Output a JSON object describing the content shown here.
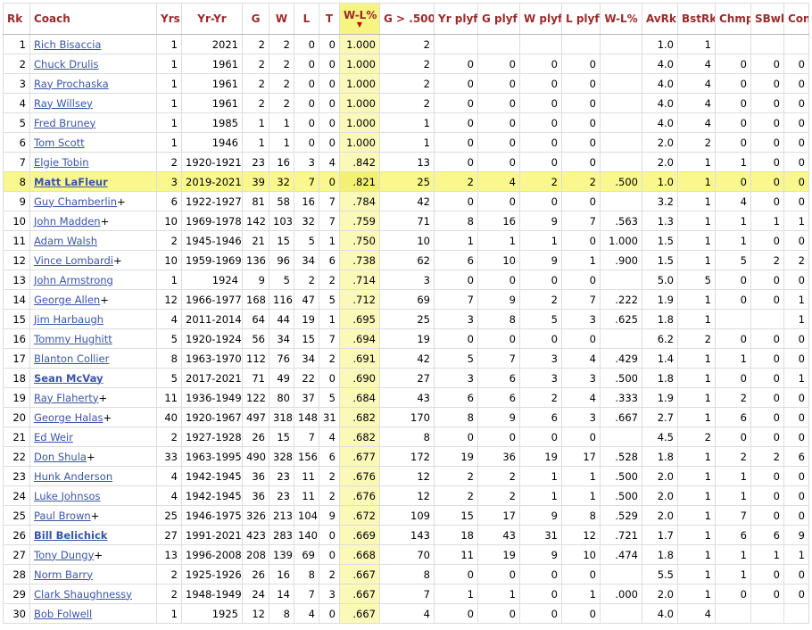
{
  "columns": [
    {
      "label": "Rk"
    },
    {
      "label": "Coach"
    },
    {
      "label": "Yrs"
    },
    {
      "label": "Yr-Yr"
    },
    {
      "label": "G"
    },
    {
      "label": "W"
    },
    {
      "label": "L"
    },
    {
      "label": "T"
    },
    {
      "label": "W-L%",
      "sort_indicator": "▼"
    },
    {
      "label": "G > .500"
    },
    {
      "label": "Yr plyf"
    },
    {
      "label": "G plyf"
    },
    {
      "label": "W plyf"
    },
    {
      "label": "L plyf"
    },
    {
      "label": "W-L%"
    },
    {
      "label": "AvRk"
    },
    {
      "label": "BstRk"
    },
    {
      "label": "Chmp"
    },
    {
      "label": "SBwl"
    },
    {
      "label": "Conf"
    }
  ],
  "rows": [
    {
      "rk": "1",
      "coach": "Rich Bisaccia",
      "hof": "",
      "bold": false,
      "highlight": false,
      "cells": [
        "1",
        "2021",
        "2",
        "2",
        "0",
        "0",
        "1.000",
        "2",
        "",
        "",
        "",
        "",
        "",
        "1.0",
        "1",
        "",
        "",
        ""
      ]
    },
    {
      "rk": "2",
      "coach": "Chuck Drulis",
      "hof": "",
      "bold": false,
      "highlight": false,
      "cells": [
        "1",
        "1961",
        "2",
        "2",
        "0",
        "0",
        "1.000",
        "2",
        "0",
        "0",
        "0",
        "0",
        "",
        "4.0",
        "4",
        "0",
        "0",
        "0"
      ]
    },
    {
      "rk": "3",
      "coach": "Ray Prochaska",
      "hof": "",
      "bold": false,
      "highlight": false,
      "cells": [
        "1",
        "1961",
        "2",
        "2",
        "0",
        "0",
        "1.000",
        "2",
        "0",
        "0",
        "0",
        "0",
        "",
        "4.0",
        "4",
        "0",
        "0",
        "0"
      ]
    },
    {
      "rk": "4",
      "coach": "Ray Willsey",
      "hof": "",
      "bold": false,
      "highlight": false,
      "cells": [
        "1",
        "1961",
        "2",
        "2",
        "0",
        "0",
        "1.000",
        "2",
        "0",
        "0",
        "0",
        "0",
        "",
        "4.0",
        "4",
        "0",
        "0",
        "0"
      ]
    },
    {
      "rk": "5",
      "coach": "Fred Bruney",
      "hof": "",
      "bold": false,
      "highlight": false,
      "cells": [
        "1",
        "1985",
        "1",
        "1",
        "0",
        "0",
        "1.000",
        "1",
        "0",
        "0",
        "0",
        "0",
        "",
        "4.0",
        "4",
        "0",
        "0",
        "0"
      ]
    },
    {
      "rk": "6",
      "coach": "Tom Scott",
      "hof": "",
      "bold": false,
      "highlight": false,
      "cells": [
        "1",
        "1946",
        "1",
        "1",
        "0",
        "0",
        "1.000",
        "1",
        "0",
        "0",
        "0",
        "0",
        "",
        "2.0",
        "2",
        "0",
        "0",
        "0"
      ]
    },
    {
      "rk": "7",
      "coach": "Elgie Tobin",
      "hof": "",
      "bold": false,
      "highlight": false,
      "cells": [
        "2",
        "1920-1921",
        "23",
        "16",
        "3",
        "4",
        ".842",
        "13",
        "0",
        "0",
        "0",
        "0",
        "",
        "2.0",
        "1",
        "1",
        "0",
        "0"
      ]
    },
    {
      "rk": "8",
      "coach": "Matt LaFleur",
      "hof": "",
      "bold": true,
      "highlight": true,
      "cells": [
        "3",
        "2019-2021",
        "39",
        "32",
        "7",
        "0",
        ".821",
        "25",
        "2",
        "4",
        "2",
        "2",
        ".500",
        "1.0",
        "1",
        "0",
        "0",
        "0"
      ]
    },
    {
      "rk": "9",
      "coach": "Guy Chamberlin",
      "hof": "+",
      "bold": false,
      "highlight": false,
      "cells": [
        "6",
        "1922-1927",
        "81",
        "58",
        "16",
        "7",
        ".784",
        "42",
        "0",
        "0",
        "0",
        "0",
        "",
        "3.2",
        "1",
        "4",
        "0",
        "0"
      ]
    },
    {
      "rk": "10",
      "coach": "John Madden",
      "hof": "+",
      "bold": false,
      "highlight": false,
      "cells": [
        "10",
        "1969-1978",
        "142",
        "103",
        "32",
        "7",
        ".759",
        "71",
        "8",
        "16",
        "9",
        "7",
        ".563",
        "1.3",
        "1",
        "1",
        "1",
        "1"
      ]
    },
    {
      "rk": "11",
      "coach": "Adam Walsh",
      "hof": "",
      "bold": false,
      "highlight": false,
      "cells": [
        "2",
        "1945-1946",
        "21",
        "15",
        "5",
        "1",
        ".750",
        "10",
        "1",
        "1",
        "1",
        "0",
        "1.000",
        "1.5",
        "1",
        "1",
        "0",
        "0"
      ]
    },
    {
      "rk": "12",
      "coach": "Vince Lombardi",
      "hof": "+",
      "bold": false,
      "highlight": false,
      "cells": [
        "10",
        "1959-1969",
        "136",
        "96",
        "34",
        "6",
        ".738",
        "62",
        "6",
        "10",
        "9",
        "1",
        ".900",
        "1.5",
        "1",
        "5",
        "2",
        "2"
      ]
    },
    {
      "rk": "13",
      "coach": "John Armstrong",
      "hof": "",
      "bold": false,
      "highlight": false,
      "cells": [
        "1",
        "1924",
        "9",
        "5",
        "2",
        "2",
        ".714",
        "3",
        "0",
        "0",
        "0",
        "0",
        "",
        "5.0",
        "5",
        "0",
        "0",
        "0"
      ]
    },
    {
      "rk": "14",
      "coach": "George Allen",
      "hof": "+",
      "bold": false,
      "highlight": false,
      "cells": [
        "12",
        "1966-1977",
        "168",
        "116",
        "47",
        "5",
        ".712",
        "69",
        "7",
        "9",
        "2",
        "7",
        ".222",
        "1.9",
        "1",
        "0",
        "0",
        "1"
      ]
    },
    {
      "rk": "15",
      "coach": "Jim Harbaugh",
      "hof": "",
      "bold": false,
      "highlight": false,
      "cells": [
        "4",
        "2011-2014",
        "64",
        "44",
        "19",
        "1",
        ".695",
        "25",
        "3",
        "8",
        "5",
        "3",
        ".625",
        "1.8",
        "1",
        "",
        "",
        "1"
      ]
    },
    {
      "rk": "16",
      "coach": "Tommy Hughitt",
      "hof": "",
      "bold": false,
      "highlight": false,
      "cells": [
        "5",
        "1920-1924",
        "56",
        "34",
        "15",
        "7",
        ".694",
        "19",
        "0",
        "0",
        "0",
        "0",
        "",
        "6.2",
        "2",
        "0",
        "0",
        "0"
      ]
    },
    {
      "rk": "17",
      "coach": "Blanton Collier",
      "hof": "",
      "bold": false,
      "highlight": false,
      "cells": [
        "8",
        "1963-1970",
        "112",
        "76",
        "34",
        "2",
        ".691",
        "42",
        "5",
        "7",
        "3",
        "4",
        ".429",
        "1.4",
        "1",
        "1",
        "0",
        "0"
      ]
    },
    {
      "rk": "18",
      "coach": "Sean McVay",
      "hof": "",
      "bold": true,
      "highlight": false,
      "cells": [
        "5",
        "2017-2021",
        "71",
        "49",
        "22",
        "0",
        ".690",
        "27",
        "3",
        "6",
        "3",
        "3",
        ".500",
        "1.8",
        "1",
        "0",
        "0",
        "1"
      ]
    },
    {
      "rk": "19",
      "coach": "Ray Flaherty",
      "hof": "+",
      "bold": false,
      "highlight": false,
      "cells": [
        "11",
        "1936-1949",
        "122",
        "80",
        "37",
        "5",
        ".684",
        "43",
        "6",
        "6",
        "2",
        "4",
        ".333",
        "1.9",
        "1",
        "2",
        "0",
        "0"
      ]
    },
    {
      "rk": "20",
      "coach": "George Halas",
      "hof": "+",
      "bold": false,
      "highlight": false,
      "cells": [
        "40",
        "1920-1967",
        "497",
        "318",
        "148",
        "31",
        ".682",
        "170",
        "8",
        "9",
        "6",
        "3",
        ".667",
        "2.7",
        "1",
        "6",
        "0",
        "0"
      ]
    },
    {
      "rk": "21",
      "coach": "Ed Weir",
      "hof": "",
      "bold": false,
      "highlight": false,
      "cells": [
        "2",
        "1927-1928",
        "26",
        "15",
        "7",
        "4",
        ".682",
        "8",
        "0",
        "0",
        "0",
        "0",
        "",
        "4.5",
        "2",
        "0",
        "0",
        "0"
      ]
    },
    {
      "rk": "22",
      "coach": "Don Shula",
      "hof": "+",
      "bold": false,
      "highlight": false,
      "cells": [
        "33",
        "1963-1995",
        "490",
        "328",
        "156",
        "6",
        ".677",
        "172",
        "19",
        "36",
        "19",
        "17",
        ".528",
        "1.8",
        "1",
        "2",
        "2",
        "6"
      ]
    },
    {
      "rk": "23",
      "coach": "Hunk Anderson",
      "hof": "",
      "bold": false,
      "highlight": false,
      "cells": [
        "4",
        "1942-1945",
        "36",
        "23",
        "11",
        "2",
        ".676",
        "12",
        "2",
        "2",
        "1",
        "1",
        ".500",
        "2.0",
        "1",
        "1",
        "0",
        "0"
      ]
    },
    {
      "rk": "24",
      "coach": "Luke Johnsos",
      "hof": "",
      "bold": false,
      "highlight": false,
      "cells": [
        "4",
        "1942-1945",
        "36",
        "23",
        "11",
        "2",
        ".676",
        "12",
        "2",
        "2",
        "1",
        "1",
        ".500",
        "2.0",
        "1",
        "1",
        "0",
        "0"
      ]
    },
    {
      "rk": "25",
      "coach": "Paul Brown",
      "hof": "+",
      "bold": false,
      "highlight": false,
      "cells": [
        "25",
        "1946-1975",
        "326",
        "213",
        "104",
        "9",
        ".672",
        "109",
        "15",
        "17",
        "9",
        "8",
        ".529",
        "2.0",
        "1",
        "7",
        "0",
        "0"
      ]
    },
    {
      "rk": "26",
      "coach": "Bill Belichick",
      "hof": "",
      "bold": true,
      "highlight": false,
      "cells": [
        "27",
        "1991-2021",
        "423",
        "283",
        "140",
        "0",
        ".669",
        "143",
        "18",
        "43",
        "31",
        "12",
        ".721",
        "1.7",
        "1",
        "6",
        "6",
        "9"
      ]
    },
    {
      "rk": "27",
      "coach": "Tony Dungy",
      "hof": "+",
      "bold": false,
      "highlight": false,
      "cells": [
        "13",
        "1996-2008",
        "208",
        "139",
        "69",
        "0",
        ".668",
        "70",
        "11",
        "19",
        "9",
        "10",
        ".474",
        "1.8",
        "1",
        "1",
        "1",
        "1"
      ]
    },
    {
      "rk": "28",
      "coach": "Norm Barry",
      "hof": "",
      "bold": false,
      "highlight": false,
      "cells": [
        "2",
        "1925-1926",
        "26",
        "16",
        "8",
        "2",
        ".667",
        "8",
        "0",
        "0",
        "0",
        "0",
        "",
        "5.5",
        "1",
        "1",
        "0",
        "0"
      ]
    },
    {
      "rk": "29",
      "coach": "Clark Shaughnessy",
      "hof": "",
      "bold": false,
      "highlight": false,
      "cells": [
        "2",
        "1948-1949",
        "24",
        "14",
        "7",
        "3",
        ".667",
        "7",
        "1",
        "1",
        "0",
        "1",
        ".000",
        "2.0",
        "1",
        "0",
        "0",
        "0"
      ]
    },
    {
      "rk": "30",
      "coach": "Bob Folwell",
      "hof": "",
      "bold": false,
      "highlight": false,
      "cells": [
        "1",
        "1925",
        "12",
        "8",
        "4",
        "0",
        ".667",
        "4",
        "0",
        "0",
        "0",
        "0",
        "",
        "4.0",
        "4",
        "",
        "",
        ""
      ]
    }
  ]
}
